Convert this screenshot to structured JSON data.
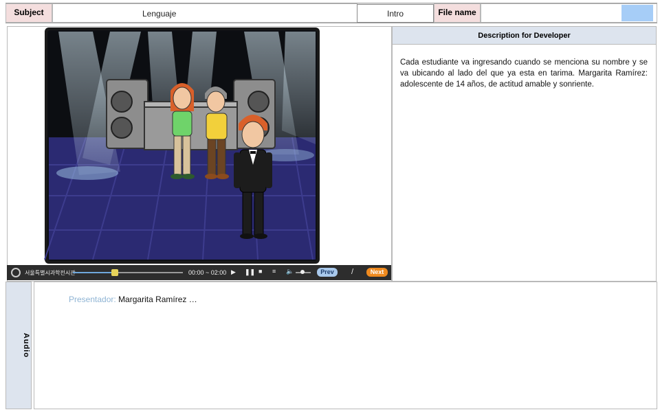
{
  "header": {
    "subject_label": "Subject",
    "subject_value": "Lenguaje",
    "scene_value": "Intro",
    "file_name_label": "File name",
    "file_name_value": ""
  },
  "description": {
    "title": "Description for Developer",
    "text": "Cada estudiante va ingresando cuando se menciona su nombre y se va ubicando al lado del que ya esta en tarima. Margarita Ramírez: adolescente de 14 años, de actitud amable y sonriente."
  },
  "player": {
    "logo_text": "서울특별시과학전시관",
    "time": "00:00 ~ 02:00",
    "prev_label": "Prev",
    "separator": "/",
    "next_label": "Next",
    "progress": 0.38,
    "volume": 0.45
  },
  "audio": {
    "side_label": "Audio",
    "speaker_label": "Presentador:",
    "speech_text": "Margarita Ramírez …"
  },
  "colors": {
    "label_pink": "#f4dede",
    "header_blue": "#dde4ee",
    "speaker_label": "#8fb4d4",
    "next_orange": "#ef8a1f",
    "prev_blue": "#a9c9ec",
    "file_swatch": "#a6cdf7"
  }
}
